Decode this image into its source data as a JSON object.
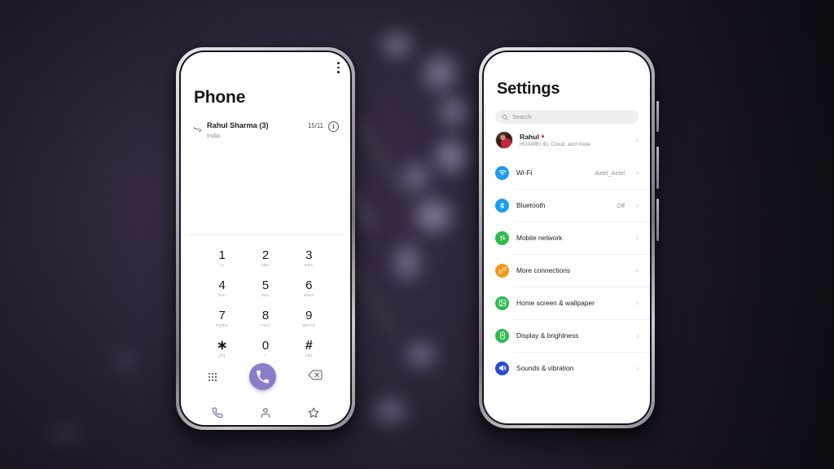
{
  "background": {
    "description": "blurred dark purple wallpaper",
    "base_color": "#3a2e48",
    "edge_color": "#16121c"
  },
  "phone_app": {
    "title": "Phone",
    "menu_icon": "more-vertical-icon",
    "call_log": {
      "type_icon": "missed-call-icon",
      "name": "Rahul Sharma (3)",
      "location": "India",
      "date": "15/11",
      "info_icon": "info-circle-icon",
      "info_glyph": "i"
    },
    "dialpad": [
      {
        "digit": "1",
        "letters": "ɔɔ"
      },
      {
        "digit": "2",
        "letters": "ABC"
      },
      {
        "digit": "3",
        "letters": "DEF"
      },
      {
        "digit": "4",
        "letters": "GHI"
      },
      {
        "digit": "5",
        "letters": "JKL"
      },
      {
        "digit": "6",
        "letters": "MNO"
      },
      {
        "digit": "7",
        "letters": "PQRS"
      },
      {
        "digit": "8",
        "letters": "TUV"
      },
      {
        "digit": "9",
        "letters": "WXYZ"
      },
      {
        "digit": "∗",
        "letters": "(P)"
      },
      {
        "digit": "0",
        "letters": "+"
      },
      {
        "digit": "#",
        "letters": "(W)"
      }
    ],
    "actions": {
      "keypad_toggle_icon": "dialpad-grid-icon",
      "call_button_icon": "phone-handset-icon",
      "call_button_color": "#8b7dc9",
      "backspace_icon": "backspace-icon"
    },
    "tabs": [
      {
        "icon": "phone-icon",
        "name": "tab-dialer",
        "active": true
      },
      {
        "icon": "person-icon",
        "name": "tab-contacts",
        "active": false
      },
      {
        "icon": "star-icon",
        "name": "tab-favorites",
        "active": false
      }
    ]
  },
  "settings_app": {
    "title": "Settings",
    "search": {
      "icon": "search-icon",
      "placeholder": "Search"
    },
    "account": {
      "avatar_icon": "user-avatar",
      "name": "Rahul",
      "badge": "new-update-dot",
      "subtitle": "HUAWEI ID, Cloud, and more",
      "chevron": "›"
    },
    "items": [
      {
        "label": "Wi-Fi",
        "value": "Airtel_Airtel",
        "icon": "wifi-icon",
        "color": "#1a9cf0"
      },
      {
        "label": "Bluetooth",
        "value": "Off",
        "icon": "bluetooth-icon",
        "color": "#1a9cf0"
      },
      {
        "label": "Mobile network",
        "value": "",
        "icon": "mobile-network-icon",
        "color": "#2dbb4e"
      },
      {
        "label": "More connections",
        "value": "",
        "icon": "link-icon",
        "color": "#f0991a"
      },
      {
        "label": "Home screen & wallpaper",
        "value": "",
        "icon": "image-icon",
        "color": "#2dbb4e"
      },
      {
        "label": "Display & brightness",
        "value": "",
        "icon": "brightness-icon",
        "color": "#2dbb4e"
      },
      {
        "label": "Sounds & vibration",
        "value": "",
        "icon": "speaker-icon",
        "color": "#2b49d8"
      }
    ],
    "chevron": "›"
  }
}
